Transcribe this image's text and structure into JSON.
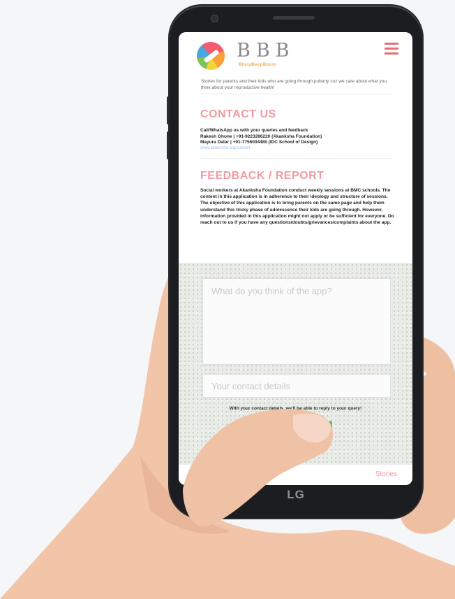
{
  "device": {
    "brand": "LG"
  },
  "app": {
    "logo_text": "BBB",
    "logo_tagline": "BlurpBeepBoom",
    "menu_icon": "hamburger-menu-icon",
    "tagline": "Stories for parents and their kids who are going through puberty coz we care about what you think about your reproductive health!"
  },
  "contact": {
    "title": "CONTACT US",
    "line1": "Call/WhatsApp us with your queries and feedback",
    "line2": "Rakesh Ghone | +91-9223286220 (Akanksha Foundation)",
    "line3": "Mayura Datar | +91-7756004480 (IDC School of Design)",
    "link": "www.akanksha.org/contact"
  },
  "feedback": {
    "title": "FEEDBACK / REPORT",
    "body": "Social workers at Akanksha Foundation conduct weekly sessions at BMC schools. The content in this application is in adherence to their ideology and structure of sessions. The objective of this application is to bring parents on the same page and help them understand this tricky phase of adolescence their kids are going through. However, information provided in this application might not apply or be sufficient for everyone. Do reach out to us if you have any questions/doubts/grievances/complaints about the app.",
    "textarea_placeholder": "What do you think of the app?",
    "contact_placeholder": "Your contact details",
    "reply_note": "With your contact details, we'll be able to reply to your query!",
    "submit_label": ""
  },
  "nav": {
    "stories_label": "Stories"
  },
  "colors": {
    "accent_pink": "#f19aa1",
    "menu_pink": "#ee6b74",
    "submit_green": "#63c452",
    "phone_body": "#1c1d20"
  }
}
